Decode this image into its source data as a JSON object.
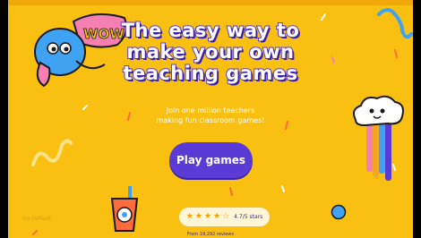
{
  "hero": {
    "line1": "The easy way to",
    "line2": "make your own",
    "line3": "teaching games"
  },
  "subtitle": {
    "line1": "Join one million teachers",
    "line2": "making fun classroom games!"
  },
  "cta": {
    "label": "Play games"
  },
  "rating": {
    "text": "4.7/5 stars",
    "stars": 5,
    "value": 4.7,
    "reviews_text": "From 19,292 reviews"
  },
  "corner_link": {
    "label": "Go Default"
  },
  "decor": {
    "sticker_text": "WOW"
  },
  "colors": {
    "background": "#f9bf11",
    "accent": "#5b3bd6",
    "text_dark": "#3d2c74"
  }
}
